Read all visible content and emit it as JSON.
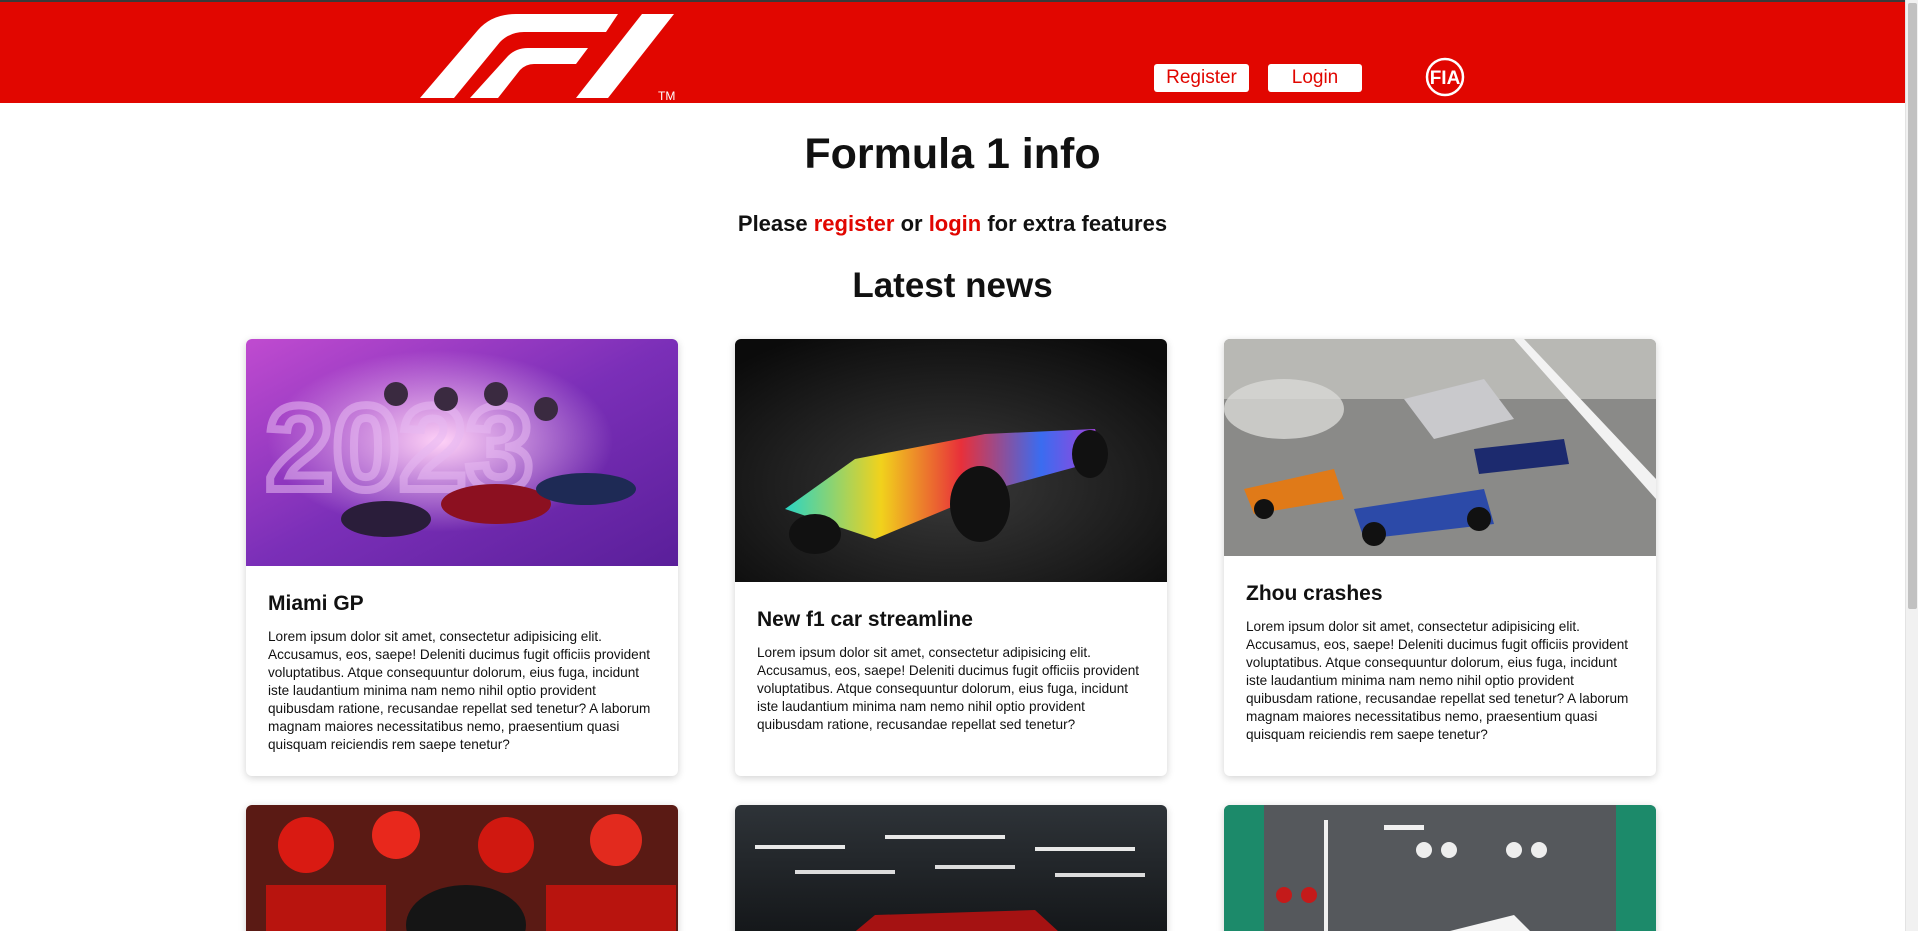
{
  "header": {
    "logo_alt": "F1",
    "trademark": "TM",
    "register_label": "Register",
    "login_label": "Login",
    "fia_label": "FIA"
  },
  "page": {
    "title": "Formula 1 info",
    "prompt_before": "Please ",
    "register_link": "register",
    "prompt_middle": " or ",
    "login_link": "login",
    "prompt_after": " for extra features",
    "news_heading": "Latest news"
  },
  "news": [
    {
      "title": "Miami GP",
      "text": "Lorem ipsum dolor sit amet, consectetur adipisicing elit. Accusamus, eos, saepe! Deleniti ducimus fugit officiis provident voluptatibus. Atque consequuntur dolorum, eius fuga, incidunt iste laudantium minima nam nemo nihil optio provident quibusdam ratione, recusandae repellat sed tenetur? A laborum magnam maiores necessitatibus nemo, praesentium quasi quisquam reiciendis rem saepe tenetur?"
    },
    {
      "title": "New f1 car streamline",
      "text": "Lorem ipsum dolor sit amet, consectetur adipisicing elit. Accusamus, eos, saepe! Deleniti ducimus fugit officiis provident voluptatibus. Atque consequuntur dolorum, eius fuga, incidunt iste laudantium minima nam nemo nihil optio provident quibusdam ratione, recusandae repellat sed tenetur?"
    },
    {
      "title": "Zhou crashes",
      "text": "Lorem ipsum dolor sit amet, consectetur adipisicing elit. Accusamus, eos, saepe! Deleniti ducimus fugit officiis provident voluptatibus. Atque consequuntur dolorum, eius fuga, incidunt iste laudantium minima nam nemo nihil optio provident quibusdam ratione, recusandae repellat sed tenetur? A laborum magnam maiores necessitatibus nemo, praesentium quasi quisquam reiciendis rem saepe tenetur?"
    }
  ],
  "colors": {
    "brand_red": "#e10600",
    "white": "#ffffff"
  }
}
